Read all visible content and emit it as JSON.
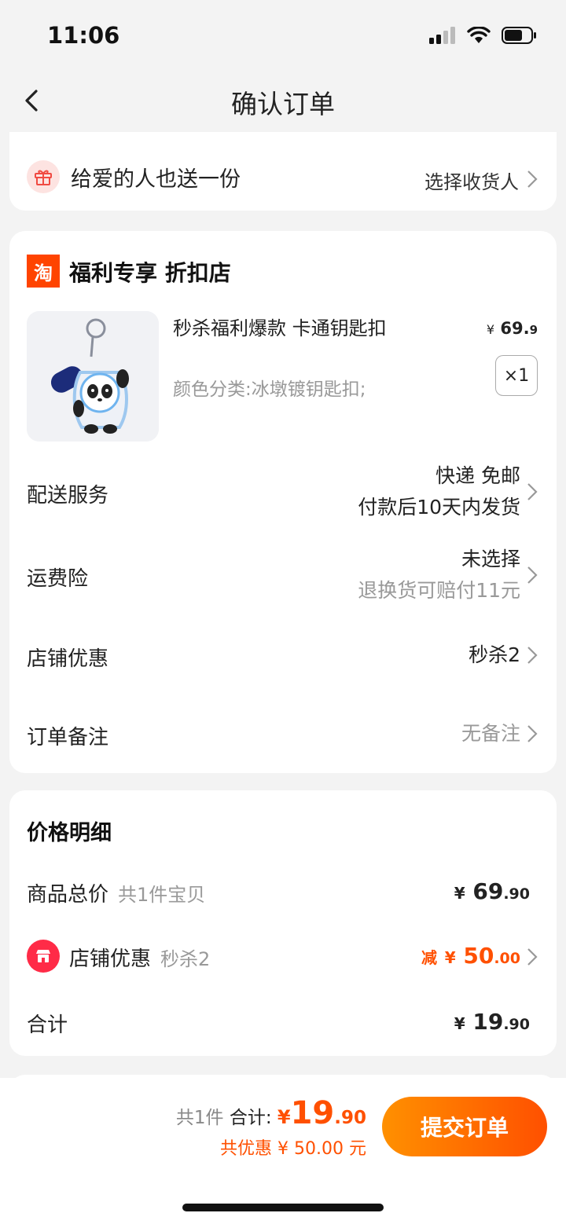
{
  "status": {
    "time": "11:06"
  },
  "nav": {
    "title": "确认订单"
  },
  "gift": {
    "text": "给爱的人也送一份",
    "action": "选择收货人"
  },
  "shop": {
    "logo_char": "淘",
    "name": "福利专享 折扣店",
    "product": {
      "title": "秒杀福利爆款 卡通钥匙扣",
      "spec": "颜色分类:冰墩镀钥匙扣;",
      "price_symbol": "¥",
      "price_int": "69.",
      "price_dec": "9",
      "qty": "×1"
    },
    "rows": [
      {
        "label": "配送服务",
        "line1": "快递 免邮",
        "line2": "付款后10天内发货"
      },
      {
        "label": "运费险",
        "line1": "未选择",
        "line2": "退换货可赔付11元"
      },
      {
        "label": "店铺优惠",
        "value": "秒杀2"
      },
      {
        "label": "订单备注",
        "value": "无备注"
      }
    ]
  },
  "price_detail": {
    "title": "价格明细",
    "goods_label": "商品总价",
    "goods_sub": "共1件宝贝",
    "goods_int": "69",
    "goods_dec": ".90",
    "discount_label": "店铺优惠",
    "discount_sub": "秒杀2",
    "discount_prefix": "减",
    "discount_int": "50",
    "discount_dec": ".00",
    "total_label": "合计",
    "total_int": "19",
    "total_dec": ".90",
    "currency": "¥"
  },
  "footer": {
    "count": "共1件",
    "total_label": "合计:",
    "currency": "¥",
    "total_int": "19",
    "total_dec": ".90",
    "discount_text": "共优惠 ¥ 50.00 元",
    "submit_label": "提交订单"
  }
}
